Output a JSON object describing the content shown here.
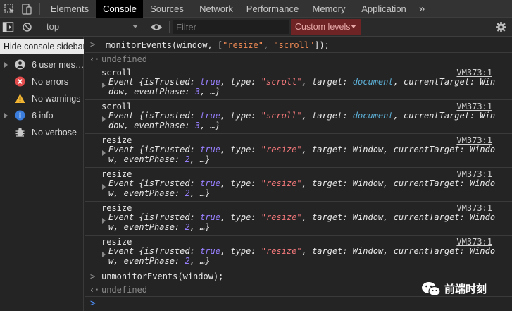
{
  "tabs": [
    "Elements",
    "Console",
    "Sources",
    "Network",
    "Performance",
    "Memory",
    "Application"
  ],
  "more_tabs_glyph": "»",
  "toolbar": {
    "context": "top",
    "filter_placeholder": "Filter",
    "levels_label": "Custom levels"
  },
  "sidebar": {
    "tooltip": "Hide console sidebar",
    "items": [
      {
        "label": "6 user mes…",
        "icon": "user-icon",
        "expandable": true
      },
      {
        "label": "No errors",
        "icon": "error-icon",
        "expandable": false
      },
      {
        "label": "No warnings",
        "icon": "warning-icon",
        "expandable": false
      },
      {
        "label": "6 info",
        "icon": "info-icon",
        "expandable": true
      },
      {
        "label": "No verbose",
        "icon": "verbose-icon",
        "expandable": false
      }
    ]
  },
  "console": {
    "command1": {
      "fn": "monitorEvents(window, [",
      "arg1": "\"resize\"",
      "sep": ", ",
      "arg2": "\"scroll\"",
      "end": "]);"
    },
    "result1": "undefined",
    "events": [
      {
        "name": "scroll",
        "source": "VM373:1",
        "type_value": "\"scroll\"",
        "target": "document",
        "current_target_a": "Win",
        "current_target_b": "dow",
        "phase": "3"
      },
      {
        "name": "scroll",
        "source": "VM373:1",
        "type_value": "\"scroll\"",
        "target": "document",
        "current_target_a": "Win",
        "current_target_b": "dow",
        "phase": "3"
      },
      {
        "name": "resize",
        "source": "VM373:1",
        "type_value": "\"resize\"",
        "target": "Window",
        "current_target_a": "Windo",
        "current_target_b": "w",
        "phase": "2"
      },
      {
        "name": "resize",
        "source": "VM373:1",
        "type_value": "\"resize\"",
        "target": "Window",
        "current_target_a": "Windo",
        "current_target_b": "w",
        "phase": "2"
      },
      {
        "name": "resize",
        "source": "VM373:1",
        "type_value": "\"resize\"",
        "target": "Window",
        "current_target_a": "Windo",
        "current_target_b": "w",
        "phase": "2"
      },
      {
        "name": "resize",
        "source": "VM373:1",
        "type_value": "\"resize\"",
        "target": "Window",
        "current_target_a": "Windo",
        "current_target_b": "w",
        "phase": "2"
      }
    ],
    "command2": "unmonitorEvents(window);",
    "result2": "undefined"
  },
  "watermark": "前端时刻",
  "colors": {
    "active_tab_bg": "#000000",
    "levels_bg": "#6e2424",
    "string": "#f2777a",
    "boolean": "#9980ff",
    "link_value": "#5db0d7",
    "prompt_caret": "#4f8ff7"
  }
}
